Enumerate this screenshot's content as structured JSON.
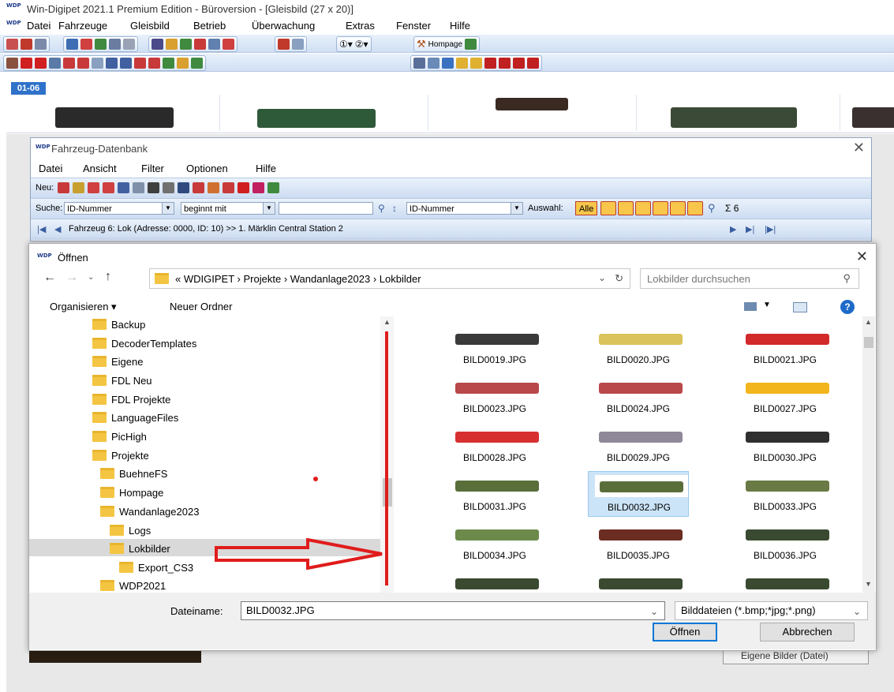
{
  "app": {
    "title": "Win-Digipet 2021.1 Premium Edition - Büroversion - [Gleisbild (27 x 20)]",
    "logo": "WDP",
    "menu": [
      "Datei",
      "Fahrzeuge",
      "Gleisbild",
      "Betrieb",
      "Überwachung",
      "Extras",
      "Fenster",
      "Hilfe"
    ],
    "hompage_label": "Hompage"
  },
  "loco_strip": {
    "tab_label": "01-06"
  },
  "fahrzeug_db": {
    "title": "Fahrzeug-Datenbank",
    "menu": [
      "Datei",
      "Ansicht",
      "Filter",
      "Optionen",
      "Hilfe"
    ],
    "neu_label": "Neu:",
    "suche_label": "Suche:",
    "search_field": "ID-Nummer",
    "match_mode": "beginnt mit",
    "search_value": "",
    "sort_field": "ID-Nummer",
    "auswahl_label": "Auswahl:",
    "alle_label": "Alle",
    "sum_label": "Σ 6",
    "current_vehicle": "Fahrzeug 6: Lok (Adresse: 0000, ID: 10) >> 1. Märklin Central Station 2"
  },
  "open_dialog": {
    "title": "Öffnen",
    "breadcrumb": [
      "«",
      "WDIGIPET",
      "Projekte",
      "Wandanlage2023",
      "Lokbilder"
    ],
    "search_placeholder": "Lokbilder durchsuchen",
    "organize_label": "Organisieren ▾",
    "new_folder_label": "Neuer Ordner",
    "tree": [
      {
        "name": "Backup",
        "level": 0
      },
      {
        "name": "DecoderTemplates",
        "level": 0
      },
      {
        "name": "Eigene",
        "level": 0
      },
      {
        "name": "FDL Neu",
        "level": 0
      },
      {
        "name": "FDL Projekte",
        "level": 0
      },
      {
        "name": "LanguageFiles",
        "level": 0
      },
      {
        "name": "PicHigh",
        "level": 0
      },
      {
        "name": "Projekte",
        "level": 0
      },
      {
        "name": "BuehneFS",
        "level": 1
      },
      {
        "name": "Hompage",
        "level": 1
      },
      {
        "name": "Wandanlage2023",
        "level": 1
      },
      {
        "name": "Logs",
        "level": 2
      },
      {
        "name": "Lokbilder",
        "level": 2,
        "selected": true
      },
      {
        "name": "Export_CS3",
        "level": 3
      },
      {
        "name": "WDP2021",
        "level": 1
      }
    ],
    "files": [
      {
        "name": "BILD0019.JPG",
        "color": "#3a3a3a"
      },
      {
        "name": "BILD0020.JPG",
        "color": "#d9c35a"
      },
      {
        "name": "BILD0021.JPG",
        "color": "#d22a2a"
      },
      {
        "name": "BILD0023.JPG",
        "color": "#b8484a"
      },
      {
        "name": "BILD0024.JPG",
        "color": "#b8484a"
      },
      {
        "name": "BILD0027.JPG",
        "color": "#f2b51c"
      },
      {
        "name": "BILD0028.JPG",
        "color": "#d73030"
      },
      {
        "name": "BILD0029.JPG",
        "color": "#8f8898"
      },
      {
        "name": "BILD0030.JPG",
        "color": "#2f2f2f"
      },
      {
        "name": "BILD0031.JPG",
        "color": "#5a6e3a"
      },
      {
        "name": "BILD0032.JPG",
        "color": "#5a6e3a",
        "selected": true
      },
      {
        "name": "BILD0033.JPG",
        "color": "#6a7a45"
      },
      {
        "name": "BILD0034.JPG",
        "color": "#6c8a4a"
      },
      {
        "name": "BILD0035.JPG",
        "color": "#6b2d22"
      },
      {
        "name": "BILD0036.JPG",
        "color": "#394a30"
      },
      {
        "name": "",
        "color": "#394a30"
      },
      {
        "name": "",
        "color": "#394a30"
      },
      {
        "name": "",
        "color": "#394a30"
      }
    ],
    "filename_label": "Dateiname:",
    "filename_value": "BILD0032.JPG",
    "filetype_value": "Bilddateien (*.bmp;*jpg;*.png)",
    "open_button": "Öffnen",
    "cancel_button": "Abbrechen"
  },
  "background": {
    "eigene_button": "Eigene Bilder (Datei)"
  },
  "colors": {
    "accent": "#0078d7",
    "annotation": "#e01c1c",
    "toolbar": "#cfdff3"
  }
}
